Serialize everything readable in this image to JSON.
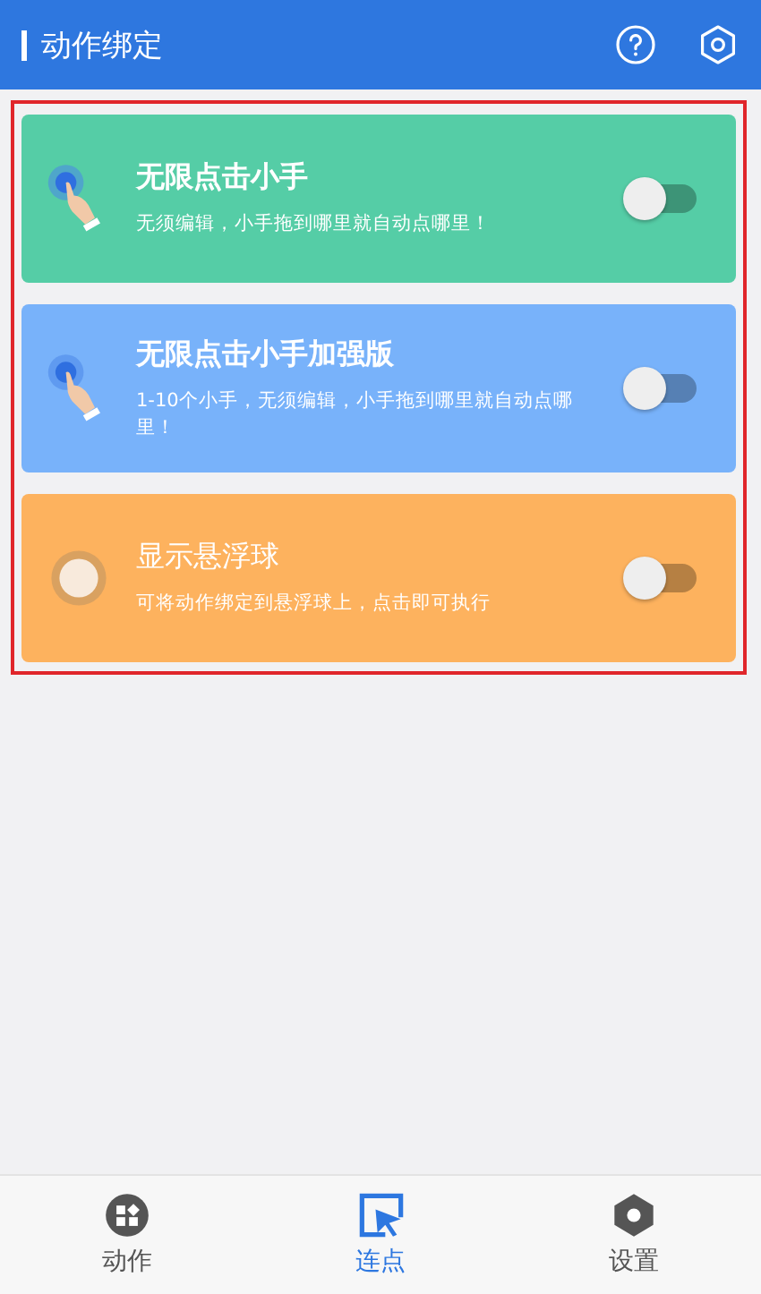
{
  "header": {
    "title": "动作绑定"
  },
  "cards": [
    {
      "kind": "hand",
      "title": "无限点击小手",
      "description": "无须编辑，小手拖到哪里就自动点哪里！",
      "color": "#55cda6",
      "on": false
    },
    {
      "kind": "hand",
      "title": "无限点击小手加强版",
      "description": "1-10个小手，无须编辑，小手拖到哪里就自动点哪里！",
      "color": "#78b2fa",
      "on": false
    },
    {
      "kind": "ball",
      "title": "显示悬浮球",
      "description": "可将动作绑定到悬浮球上，点击即可执行",
      "color": "#fdb25e",
      "on": false
    }
  ],
  "tabs": [
    {
      "kind": "actions",
      "label": "动作",
      "selected": false
    },
    {
      "kind": "clicker",
      "label": "连点",
      "selected": true
    },
    {
      "kind": "settings",
      "label": "设置",
      "selected": false
    }
  ]
}
